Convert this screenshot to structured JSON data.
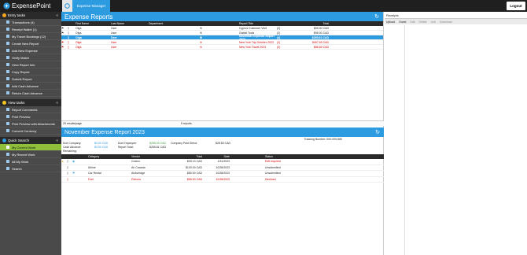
{
  "topbar": {
    "logo_text": "ExpensePoint",
    "app_tab": "Expense Manager",
    "logout_label": "Logout"
  },
  "sidebar": {
    "entry_head": "Entry tasks",
    "entry_items": [
      "Transactions (4)",
      "Receipt Wallet (1)",
      "My Travel Bookings (12)",
      "Create New Report",
      "Add New Expense",
      "Verify Match",
      "View Report Info",
      "Copy Report",
      "Submit Report",
      "Add Cash Advance",
      "Return Cash Advance"
    ],
    "view_head": "View tasks",
    "view_items": [
      "Report Comments",
      "Print Preview",
      "Print Preview with Attachments",
      "Convert Currency"
    ],
    "quick_head": "Quick Search",
    "quick_items": [
      "My Current Work",
      "My Recent Work",
      "All My Work",
      "Search"
    ]
  },
  "reports": {
    "title": "Expense Reports",
    "headers": [
      "First Name",
      "Last Name",
      "Department",
      "Report Title",
      "Total"
    ],
    "rows": [
      {
        "first": "Olga",
        "last": "User",
        "title": "Cyprus Customer Visit",
        "count": "(2)",
        "total": "$69.00 CAD"
      },
      {
        "first": "Olga",
        "last": "User",
        "title": "Gabidi Tools",
        "count": "(2)",
        "total": "$95.00 CAD"
      },
      {
        "first": "Olga",
        "last": "User",
        "title": "November Expense Report 2023",
        "count": "(4)",
        "total": "$255.61 CAD"
      },
      {
        "first": "Olga",
        "last": "User",
        "title": "New York Trip October 2023",
        "count": "(2)",
        "total": "$457.69 CAD"
      },
      {
        "first": "Olga",
        "last": "User",
        "title": "New York Travel 2023",
        "count": "(2)",
        "total": "$86.69 CAD"
      }
    ],
    "results_per_page": "20 results/page",
    "report_count": "5 reports"
  },
  "detail": {
    "title": "November Expense Report 2023",
    "tracking": "Tracking Number: 000-009-580",
    "due_company_label": "Due Company:",
    "due_company": "$0.00 CAD",
    "due_employee_label": "Due Employee:",
    "due_employee": "$255.00 CAD",
    "company_paid_label": "Company Paid Direct:",
    "company_paid": "$28.83 CAD",
    "cash_adv_label": "Cash Advance Remaining:",
    "cash_adv": "$0.00 CAD",
    "report_total_label": "Report Total:",
    "report_total": "$255.61 CAD",
    "headers": [
      "Category",
      "Vendor",
      "Total",
      "Date",
      "Status"
    ],
    "rows": [
      {
        "category": "",
        "vendor": "Costco",
        "total": "$30.13 CAD",
        "date": "1/31/2023",
        "status": "Edit required"
      },
      {
        "category": "Airline",
        "vendor": "Air Canada",
        "total": "$100.00 CAD",
        "date": "10/28/2023",
        "status": "Unsubmitted"
      },
      {
        "category": "Car Rental",
        "vendor": "AirAverage",
        "total": "$80.00 CAD",
        "date": "10/28/2023",
        "status": "Unsubmitted"
      },
      {
        "category": "Fuel",
        "vendor": "Petrons",
        "total": "$65.00 CAD",
        "date": "10/28/2023",
        "status": "Declined"
      }
    ]
  },
  "receipts": {
    "title": "Receipts",
    "tools": [
      "Upload",
      "Guest",
      "Edit",
      "Delete",
      "Link",
      "Download"
    ]
  },
  "colors": {
    "accent": "#2d9be0",
    "active": "#8fbf3a",
    "danger": "#d40000"
  }
}
